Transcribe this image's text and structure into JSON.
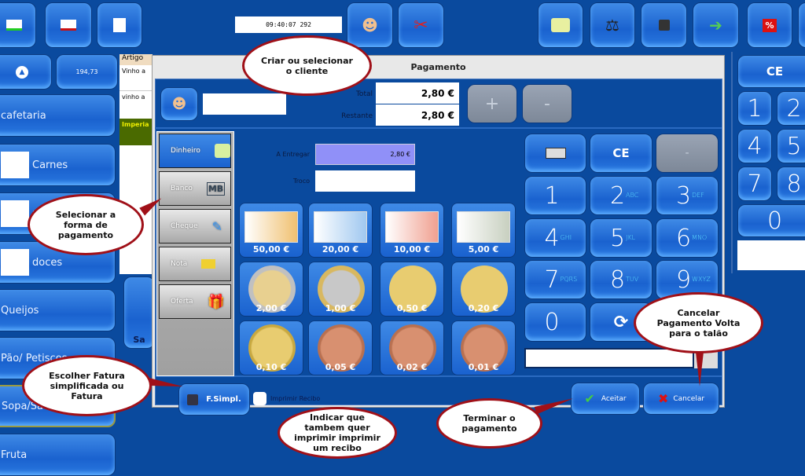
{
  "toolbar": {
    "clock": "09:40:07 292",
    "left_icons": [
      "new-document-icon",
      "remove-document-icon",
      "document-list-icon"
    ],
    "mid_icons": [
      "user-icon",
      "scissors-icon"
    ],
    "right_icons": [
      "money-icon",
      "scale-icon",
      "printer-icon",
      "transfer-arrow-icon",
      "percent-icon"
    ]
  },
  "sidebar": {
    "total": "194,73",
    "categories": [
      "cafetaria",
      "Carnes",
      "peixe",
      "doces",
      "Queijos",
      "Pão/ Petiscos",
      "Sopa/Sa",
      "Fruta"
    ]
  },
  "ticket": {
    "header": "Artigo",
    "rows": [
      "Vinho a",
      "vinho a",
      "Imperia"
    ],
    "tile_label": "Sa"
  },
  "dialog": {
    "title": "Pagamento",
    "client_value": "",
    "total_label": "Total",
    "total_value": "2,80 €",
    "remaining_label": "Restante",
    "remaining_value": "2,80 €",
    "plus_label": "+",
    "minus_label": "-",
    "deliver_label": "A Entregar",
    "deliver_value": "2,80 €",
    "change_label": "Troco",
    "change_value": "",
    "methods": [
      {
        "label": "Dinheiro",
        "icon": "cash-icon",
        "selected": true
      },
      {
        "label": "Banco",
        "icon": "multibanco-icon"
      },
      {
        "label": "Cheque",
        "icon": "cheque-icon"
      },
      {
        "label": "Nota",
        "icon": "note-icon"
      },
      {
        "label": "Oferta",
        "icon": "gift-icon"
      }
    ],
    "notes": [
      "50,00 €",
      "20,00 €",
      "10,00 €",
      "5,00 €"
    ],
    "coins_row1": [
      "2,00 €",
      "1,00 €",
      "0,50 €",
      "0,20 €"
    ],
    "coins_row2": [
      "0,10 €",
      "0,05 €",
      "0,02 €",
      "0,01 €"
    ],
    "keypad": {
      "ce": "CE",
      "minus": "-",
      "keys": [
        {
          "d": "1",
          "l": ""
        },
        {
          "d": "2",
          "l": "ABC"
        },
        {
          "d": "3",
          "l": "DEF"
        },
        {
          "d": "4",
          "l": "GHI"
        },
        {
          "d": "5",
          "l": "JKL"
        },
        {
          "d": "6",
          "l": "MNO"
        },
        {
          "d": "7",
          "l": "PQRS"
        },
        {
          "d": "8",
          "l": "TUV"
        },
        {
          "d": "9",
          "l": "WXYZ"
        },
        {
          "d": "0",
          "l": ""
        }
      ]
    },
    "invoice_type": "F.Simpl.",
    "print_receipt_label": "Imprimir Recibo",
    "print_receipt_checked": false,
    "accept": "Aceitar",
    "cancel": "Cancelar"
  },
  "right_pad": {
    "ce": "CE",
    "digits": [
      "1",
      "2",
      "4",
      "5",
      "7",
      "8",
      "0"
    ]
  },
  "callouts": {
    "client": "Criar ou selecionar o cliente",
    "method": "Selecionar a forma de pagamento",
    "invoice": "Escolher Fatura simplificada ou Fatura",
    "receipt": "Indicar que tambem quer imprimir imprimir um recibo",
    "finish": "Terminar o pagamento",
    "cancel": "Cancelar Pagamento Volta para o talão"
  },
  "colors": {
    "background": "#0a4a9e",
    "button": "#2a78e0",
    "callout_border": "#a01018",
    "deliver_field": "#9090f8"
  }
}
